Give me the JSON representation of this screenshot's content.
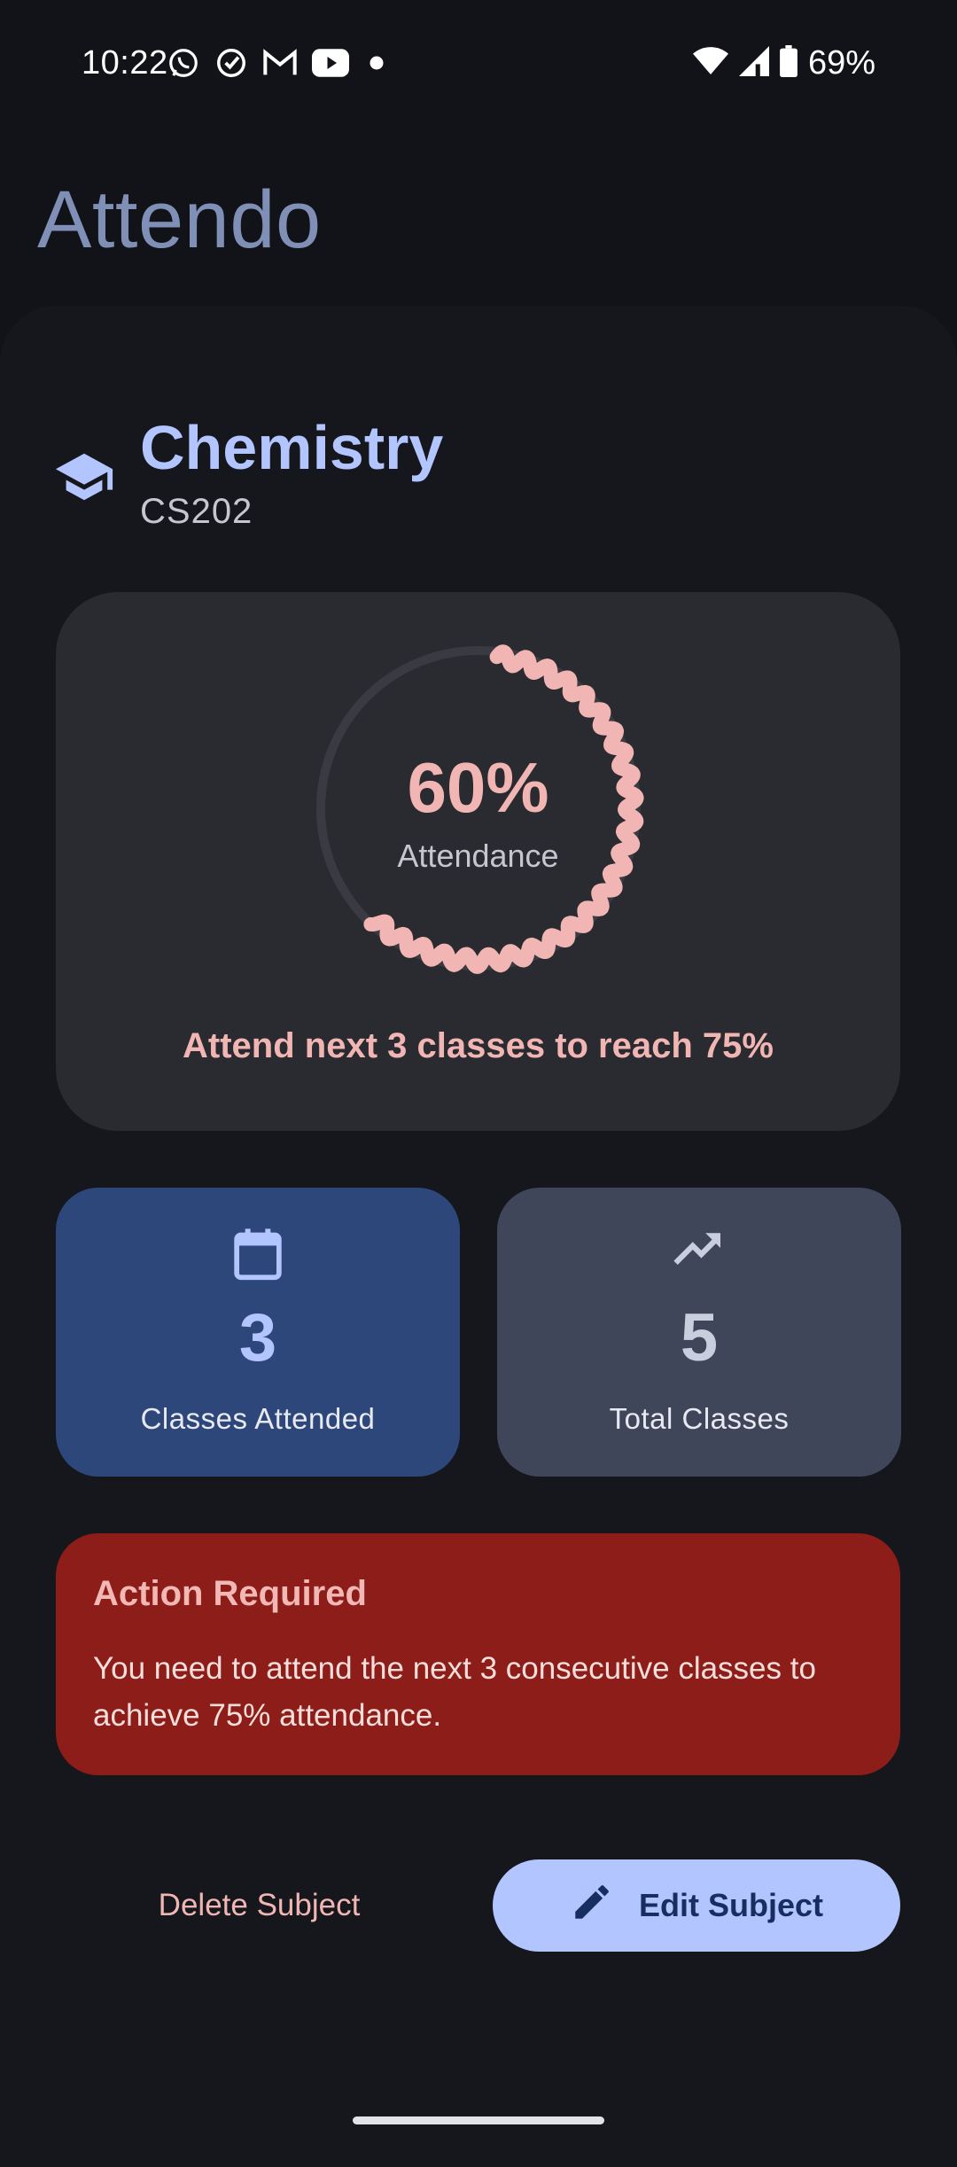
{
  "status_bar": {
    "time": "10:22",
    "battery_pct": "69%",
    "left_icons": [
      "whatsapp-icon",
      "tasks-check-icon",
      "gmail-icon",
      "youtube-icon",
      "dot-icon"
    ],
    "right_icons": [
      "wifi-icon",
      "cell-signal-icon",
      "battery-icon"
    ]
  },
  "app": {
    "title": "Attendo"
  },
  "subject": {
    "icon": "graduation-cap-icon",
    "name": "Chemistry",
    "code": "CS202"
  },
  "attendance": {
    "percent_text": "60%",
    "percent_value": 0.6,
    "label": "Attendance",
    "reach_message": "Attend next 3 classes to reach 75%",
    "progress_color": "#f1b6b4",
    "track_color": "#3a3b42"
  },
  "stats": {
    "attended": {
      "icon": "calendar-icon",
      "value": "3",
      "label": "Classes Attended"
    },
    "total": {
      "icon": "trending-up-icon",
      "value": "5",
      "label": "Total Classes"
    }
  },
  "alert": {
    "title": "Action Required",
    "body": "You need to attend the next 3 consecutive classes to achieve 75% attendance."
  },
  "actions": {
    "delete_label": "Delete Subject",
    "edit_label": "Edit Subject",
    "edit_icon": "pencil-icon"
  },
  "colors": {
    "background": "#111318",
    "accent": "#b3c5ff",
    "error_container": "#8c1d18"
  }
}
